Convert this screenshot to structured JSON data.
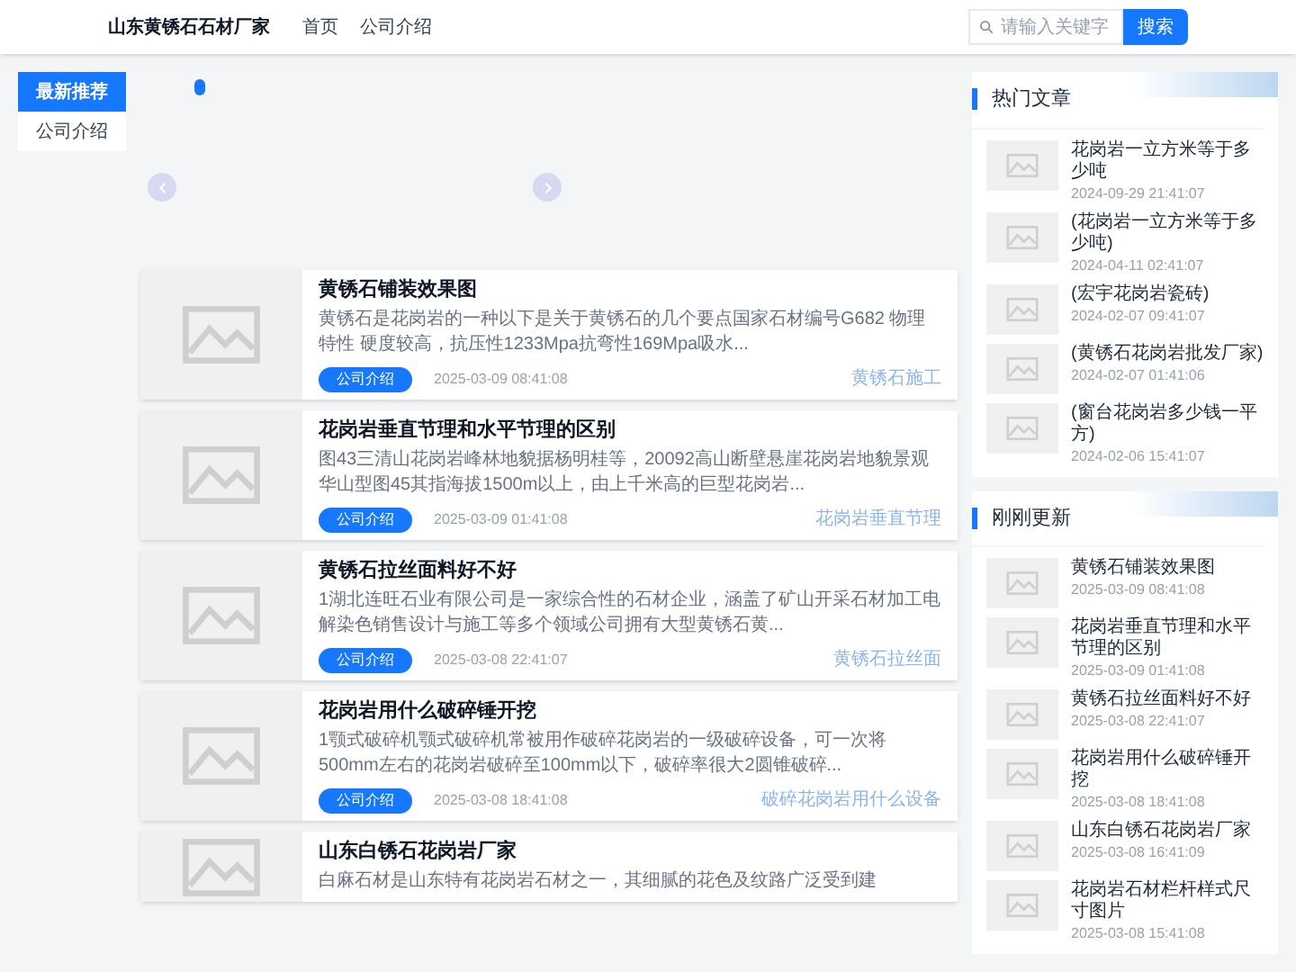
{
  "header": {
    "title": "山东黄锈石石材厂家",
    "nav": [
      {
        "label": "首页"
      },
      {
        "label": "公司介绍"
      }
    ],
    "search": {
      "placeholder": "请输入关键字",
      "button": "搜索"
    }
  },
  "side_nav": [
    {
      "label": "最新推荐",
      "selected": true
    },
    {
      "label": "公司介绍",
      "selected": false
    }
  ],
  "articles": [
    {
      "title": "黄锈石铺装效果图",
      "excerpt": "黄锈石是花岗岩的一种以下是关于黄锈石的几个要点国家石材编号G682 物理特性 硬度较高，抗压性1233Mpa抗弯性169Mpa吸水...",
      "category": "公司介绍",
      "date": "2025-03-09 08:41:08",
      "tag": "黄锈石施工"
    },
    {
      "title": "花岗岩垂直节理和水平节理的区别",
      "excerpt": "图43三清山花岗岩峰林地貌据杨明桂等，20092高山断壁悬崖花岗岩地貌景观华山型图45其指海拔1500m以上，由上千米高的巨型花岗岩...",
      "category": "公司介绍",
      "date": "2025-03-09 01:41:08",
      "tag": "花岗岩垂直节理"
    },
    {
      "title": "黄锈石拉丝面料好不好",
      "excerpt": "1湖北连旺石业有限公司是一家综合性的石材企业，涵盖了矿山开采石材加工电解染色销售设计与施工等多个领域公司拥有大型黄锈石黄...",
      "category": "公司介绍",
      "date": "2025-03-08 22:41:07",
      "tag": "黄锈石拉丝面"
    },
    {
      "title": "花岗岩用什么破碎锤开挖",
      "excerpt": "1颚式破碎机颚式破碎机常被用作破碎花岗岩的一级破碎设备，可一次将500mm左右的花岗岩破碎至100mm以下，破碎率很大2圆锥破碎...",
      "category": "公司介绍",
      "date": "2025-03-08 18:41:08",
      "tag": "破碎花岗岩用什么设备"
    },
    {
      "title": "山东白锈石花岗岩厂家",
      "excerpt": "白麻石材是山东特有花岗岩石材之一，其细腻的花色及纹路广泛受到建"
    }
  ],
  "hot": {
    "title": "热门文章",
    "items": [
      {
        "title": "花岗岩一立方米等于多少吨",
        "date": "2024-09-29 21:41:07"
      },
      {
        "title": "(花岗岩一立方米等于多少吨)",
        "date": "2024-04-11 02:41:07"
      },
      {
        "title": "(宏宇花岗岩瓷砖)",
        "date": "2024-02-07 09:41:07"
      },
      {
        "title": "(黄锈石花岗岩批发厂家)",
        "date": "2024-02-07 01:41:06"
      },
      {
        "title": "(窗台花岗岩多少钱一平方)",
        "date": "2024-02-06 15:41:07"
      }
    ]
  },
  "recent": {
    "title": "刚刚更新",
    "items": [
      {
        "title": "黄锈石铺装效果图",
        "date": "2025-03-09 08:41:08"
      },
      {
        "title": "花岗岩垂直节理和水平节理的区别",
        "date": "2025-03-09 01:41:08"
      },
      {
        "title": "黄锈石拉丝面料好不好",
        "date": "2025-03-08 22:41:07"
      },
      {
        "title": "花岗岩用什么破碎锤开挖",
        "date": "2025-03-08 18:41:08"
      },
      {
        "title": "山东白锈石花岗岩厂家",
        "date": "2025-03-08 16:41:09"
      },
      {
        "title": "花岗岩石材栏杆样式尺寸图片",
        "date": "2025-03-08 15:41:08"
      }
    ]
  }
}
